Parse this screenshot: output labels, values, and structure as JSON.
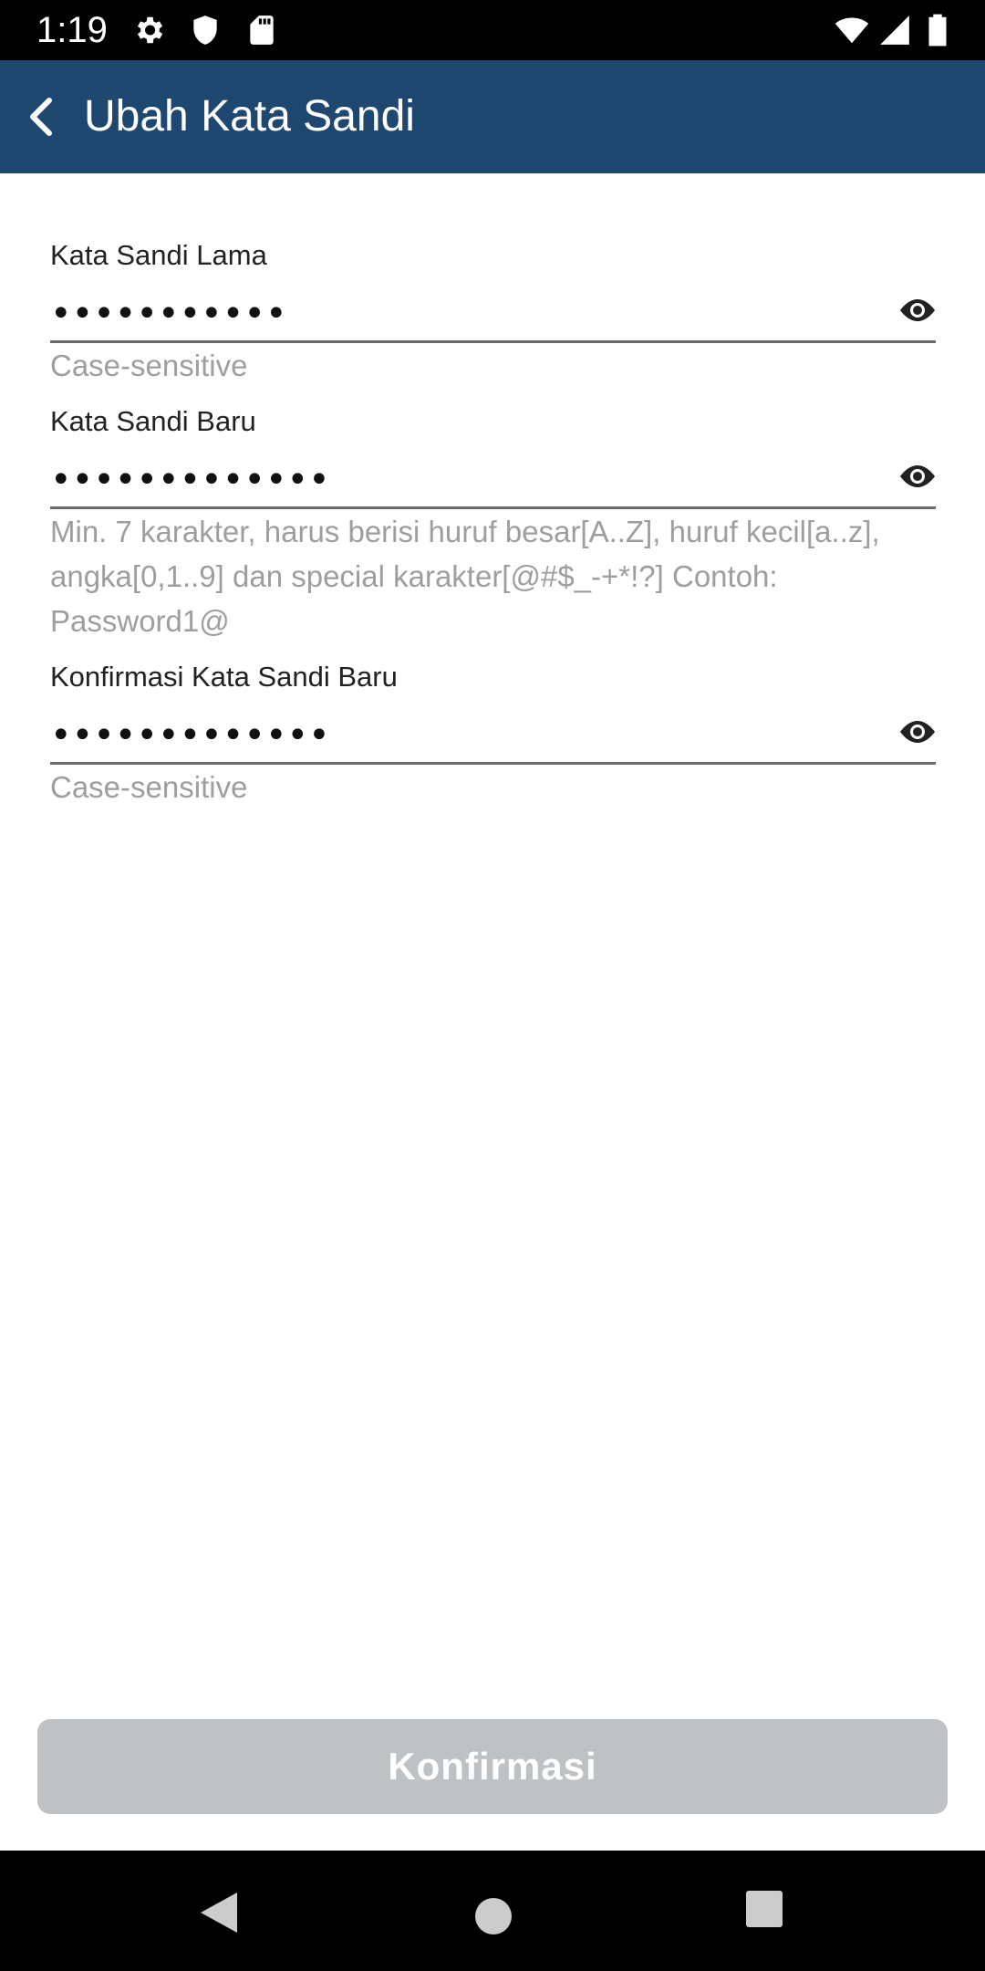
{
  "status_bar": {
    "time": "1:19",
    "left_icons": [
      "gear-icon",
      "shield-icon",
      "sd-card-icon"
    ],
    "right_icons": [
      "wifi-icon",
      "signal-icon",
      "battery-icon"
    ]
  },
  "app_bar": {
    "back_icon": "chevron-left-icon",
    "title": "Ubah Kata Sandi",
    "background_color": "#1e4870"
  },
  "form": {
    "old_password": {
      "label": "Kata Sandi Lama",
      "value": "•••••••••••",
      "helper": "Case-sensitive",
      "toggle_icon": "eye-icon"
    },
    "new_password": {
      "label": "Kata Sandi Baru",
      "value": "•••••••••••••",
      "helper": "Min. 7 karakter, harus berisi huruf besar[A..Z], huruf kecil[a..z], angka[0,1..9] dan special karakter[@#$_-+*!?] Contoh: Password1@",
      "toggle_icon": "eye-icon"
    },
    "confirm_password": {
      "label": "Konfirmasi Kata Sandi Baru",
      "value": "•••••••••••••",
      "helper": "Case-sensitive",
      "toggle_icon": "eye-icon"
    }
  },
  "confirm_button": {
    "label": "Konfirmasi",
    "state": "disabled",
    "color": "#bfc2c5"
  },
  "nav_bar": {
    "icons": [
      "nav-back-icon",
      "nav-home-icon",
      "nav-recents-icon"
    ]
  }
}
